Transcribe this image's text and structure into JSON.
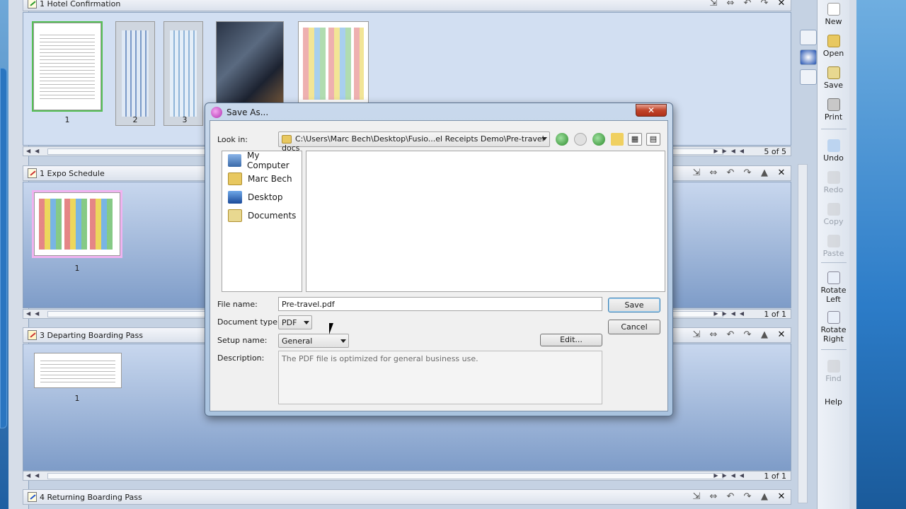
{
  "groups": [
    {
      "title": "1 Hotel Confirmation",
      "pages": "5 of 5",
      "thumbs": [
        "1",
        "2",
        "3"
      ]
    },
    {
      "title": "1 Expo Schedule",
      "pages": "1 of 1",
      "thumbs": [
        "1"
      ]
    },
    {
      "title": "3 Departing Boarding Pass",
      "pages": "1 of 1",
      "thumbs": [
        "1"
      ]
    },
    {
      "title": "4 Returning Boarding Pass"
    }
  ],
  "toolbar": {
    "new": "New",
    "open": "Open",
    "save": "Save",
    "print": "Print",
    "undo": "Undo",
    "redo": "Redo",
    "copy": "Copy",
    "paste": "Paste",
    "rotate_left": "Rotate\nLeft",
    "rotate_right": "Rotate\nRight",
    "find": "Find",
    "help": "Help"
  },
  "dialog": {
    "title": "Save As...",
    "close": "✕",
    "look_in_label": "Look in:",
    "look_in_value": "C:\\Users\\Marc Bech\\Desktop\\Fusio...el Receipts Demo\\Pre-travel docs",
    "places": [
      "My Computer",
      "Marc Bech",
      "Desktop",
      "Documents"
    ],
    "file_name_label": "File name:",
    "file_name_value": "Pre-travel.pdf",
    "doc_type_label": "Document type:",
    "doc_type_value": "PDF",
    "setup_label": "Setup name:",
    "setup_value": "General",
    "description_label": "Description:",
    "description_value": "The PDF file is optimized for general business use.",
    "save_button": "Save",
    "cancel_button": "Cancel",
    "edit_button": "Edit..."
  }
}
